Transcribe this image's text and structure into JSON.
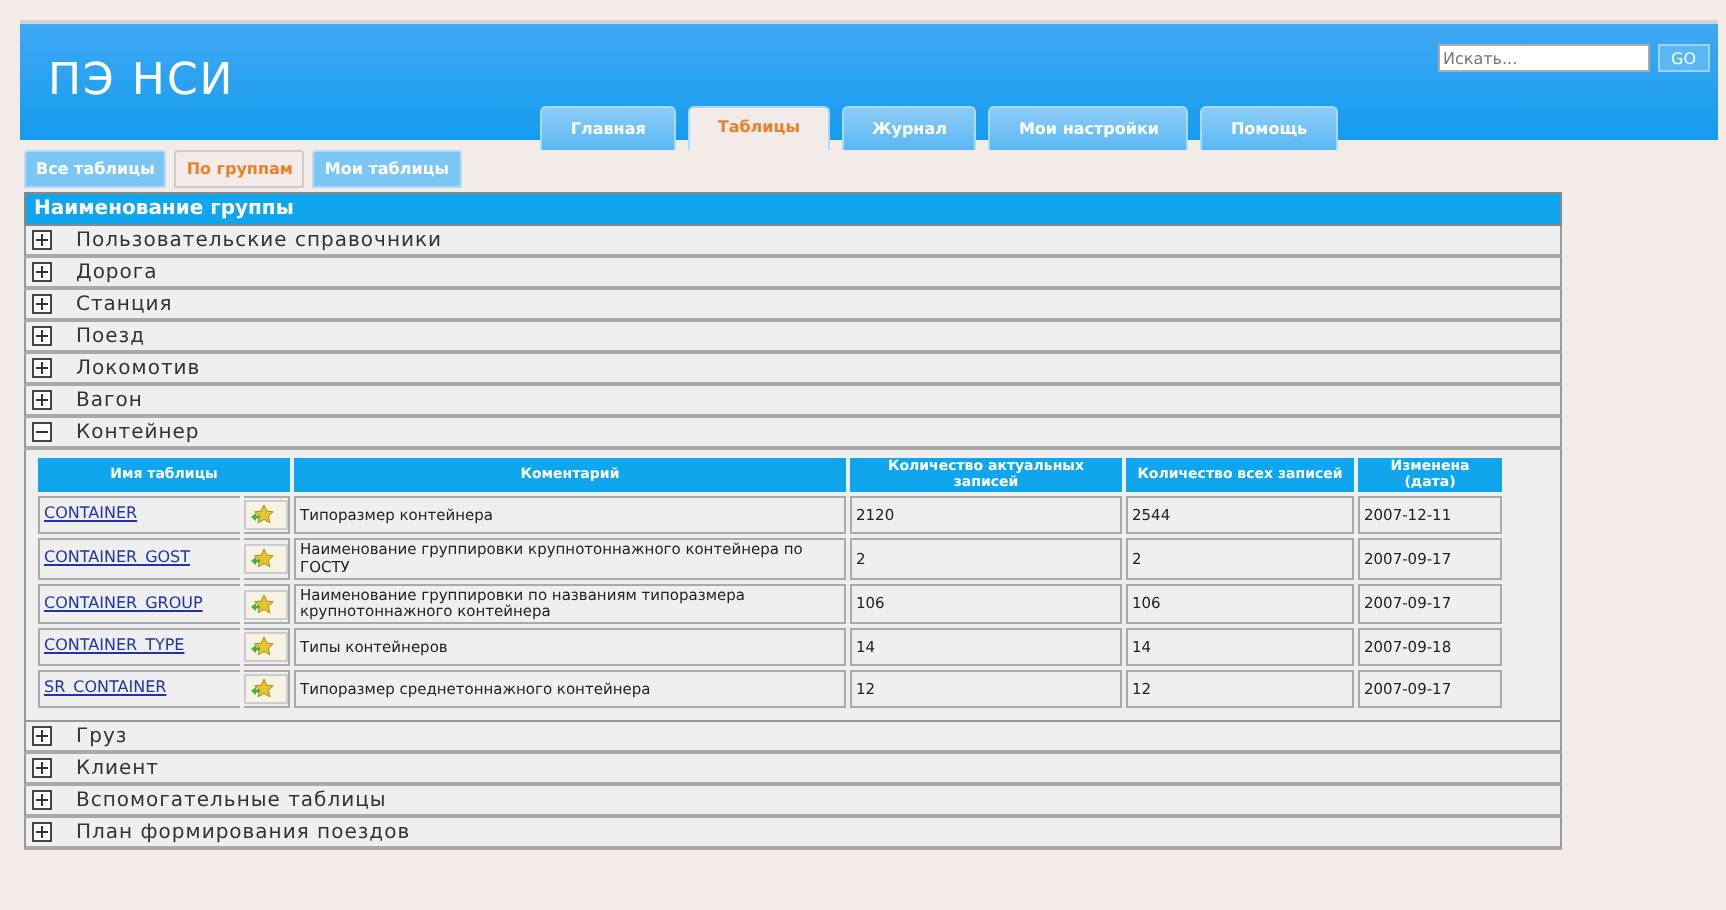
{
  "header": {
    "title": "ПЭ НСИ",
    "search": {
      "placeholder": "Искать...",
      "button": "GO"
    }
  },
  "nav_tabs": [
    {
      "label": "Главная",
      "selected": false
    },
    {
      "label": "Таблицы",
      "selected": true
    },
    {
      "label": "Журнал",
      "selected": false
    },
    {
      "label": "Мои настройки",
      "selected": false
    },
    {
      "label": "Помощь",
      "selected": false
    }
  ],
  "view_tabs": [
    {
      "label": "Все таблицы",
      "selected": false
    },
    {
      "label": "По группам",
      "selected": true
    },
    {
      "label": "Мои таблицы",
      "selected": false
    }
  ],
  "groups": {
    "heading": "Наименование группы",
    "items": [
      {
        "name": "Пользовательские справочники",
        "expanded": false
      },
      {
        "name": "Дорога",
        "expanded": false
      },
      {
        "name": "Станция",
        "expanded": false
      },
      {
        "name": "Поезд",
        "expanded": false
      },
      {
        "name": "Локомотив",
        "expanded": false
      },
      {
        "name": "Вагон",
        "expanded": false
      },
      {
        "name": "Контейнер",
        "expanded": true,
        "table": {
          "columns": [
            "Имя таблицы",
            "Коментарий",
            "Количество актуальных записей",
            "Количество всех записей",
            "Изменена (дата)"
          ],
          "rows": [
            {
              "name": "CONTAINER",
              "comment": "Типоразмер контейнера",
              "actual": "2120",
              "total": "2544",
              "changed": "2007-12-11"
            },
            {
              "name": "CONTAINER_GOST",
              "comment": "Наименование группировки крупнотоннажного контейнера по ГОСТУ",
              "actual": "2",
              "total": "2",
              "changed": "2007-09-17"
            },
            {
              "name": "CONTAINER_GROUP",
              "comment": "Наименование группировки по названиям типоразмера крупнотоннажного контейнера",
              "actual": "106",
              "total": "106",
              "changed": "2007-09-17"
            },
            {
              "name": "CONTAINER_TYPE",
              "comment": "Типы контейнеров",
              "actual": "14",
              "total": "14",
              "changed": "2007-09-18"
            },
            {
              "name": "SR_CONTAINER",
              "comment": "Типоразмер среднетоннажного контейнера",
              "actual": "12",
              "total": "12",
              "changed": "2007-09-17"
            }
          ]
        }
      },
      {
        "name": "Груз",
        "expanded": false
      },
      {
        "name": "Клиент",
        "expanded": false
      },
      {
        "name": "Вспомогательные таблицы",
        "expanded": false
      },
      {
        "name": "План формирования поездов",
        "expanded": false
      }
    ]
  }
}
